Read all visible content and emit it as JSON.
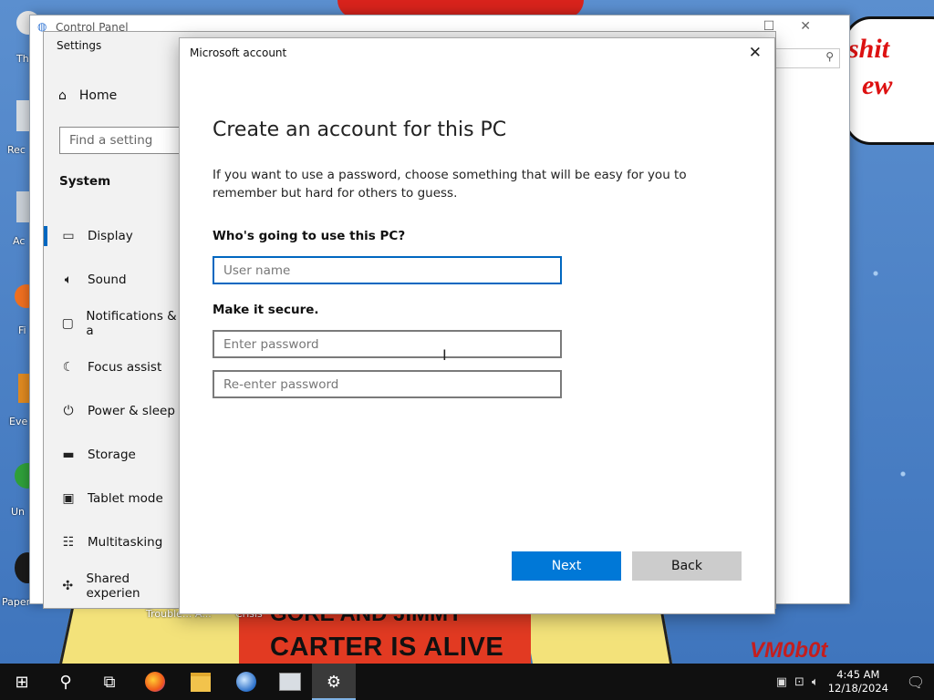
{
  "desktop": {
    "wallpaper_text_top": "GORE AND JIMMY",
    "wallpaper_text": "CARTER IS ALIVE",
    "bubble_text_1": "shit",
    "bubble_text_2": "ew",
    "signature": "VM0b0t",
    "icon_labels": [
      "Th",
      "Rec",
      "Ac",
      "Fi",
      "Eve",
      "Un",
      "Paper"
    ],
    "bottom_labels": [
      "Trouble... A...",
      "Crisis"
    ]
  },
  "control_panel": {
    "title": "Control Panel"
  },
  "settings": {
    "title": "Settings",
    "home_label": "Home",
    "search_placeholder": "Find a setting",
    "section": "System",
    "nav": [
      {
        "label": "Display",
        "icon": "display-icon",
        "selected": true
      },
      {
        "label": "Sound",
        "icon": "sound-icon"
      },
      {
        "label": "Notifications & a",
        "icon": "notifications-icon"
      },
      {
        "label": "Focus assist",
        "icon": "focus-assist-icon"
      },
      {
        "label": "Power & sleep",
        "icon": "power-icon"
      },
      {
        "label": "Storage",
        "icon": "storage-icon"
      },
      {
        "label": "Tablet mode",
        "icon": "tablet-icon"
      },
      {
        "label": "Multitasking",
        "icon": "multitasking-icon"
      },
      {
        "label": "Shared experien",
        "icon": "shared-icon"
      }
    ]
  },
  "dialog": {
    "title": "Microsoft account",
    "heading": "Create an account for this PC",
    "description": "If you want to use a password, choose something that will be easy for you to remember but hard for others to guess.",
    "question_user": "Who's going to use this PC?",
    "question_secure": "Make it secure.",
    "user_placeholder": "User name",
    "password_placeholder": "Enter password",
    "reenter_placeholder": "Re-enter password",
    "next_label": "Next",
    "back_label": "Back"
  },
  "taskbar": {
    "time": "4:45 AM",
    "date": "12/18/2024",
    "apps": [
      "start-icon",
      "search-icon",
      "task-view-icon",
      "firefox-icon",
      "file-explorer-icon",
      "browser-icon",
      "remote-icon",
      "settings-icon"
    ]
  },
  "colors": {
    "accent": "#0078d7",
    "taskbar": "#101010"
  }
}
